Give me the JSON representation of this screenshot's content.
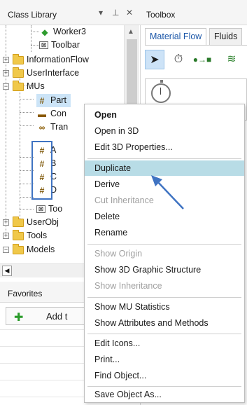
{
  "class_library": {
    "title": "Class Library",
    "header_icons": [
      "dropdown-icon",
      "pin-icon",
      "close-icon"
    ],
    "tree": {
      "items": [
        {
          "label": "Worker3",
          "icon": "worker-icon"
        },
        {
          "label": "Toolbar",
          "icon": "toolbar-icon"
        },
        {
          "label": "InformationFlow",
          "icon": "folder-icon"
        },
        {
          "label": "UserInterface",
          "icon": "folder-icon"
        },
        {
          "label": "MUs",
          "icon": "folder-icon"
        },
        {
          "label": "Part",
          "icon": "mu-part-icon"
        },
        {
          "label": "Con",
          "icon": "mu-container-icon"
        },
        {
          "label": "Tran",
          "icon": "mu-transporter-icon"
        },
        {
          "label": "A",
          "icon": "mu-part-icon"
        },
        {
          "label": "B",
          "icon": "mu-part-icon"
        },
        {
          "label": "C",
          "icon": "mu-part-icon"
        },
        {
          "label": "D",
          "icon": "mu-part-icon"
        },
        {
          "label": "Too",
          "icon": "toolbar-icon"
        },
        {
          "label": "UserObj",
          "icon": "folder-icon"
        },
        {
          "label": "Tools",
          "icon": "folder-icon"
        },
        {
          "label": "Models",
          "icon": "folder-icon"
        }
      ]
    }
  },
  "favorites": {
    "title": "Favorites",
    "add_label": "Add t"
  },
  "toolbox": {
    "title": "Toolbox",
    "tabs": [
      {
        "label": "Material Flow",
        "active": true
      },
      {
        "label": "Fluids",
        "active": false
      }
    ],
    "tools": [
      "pointer-icon",
      "stopwatch-icon",
      "connector-icon",
      "layers-icon"
    ]
  },
  "context_menu": {
    "items": [
      {
        "label": "Open",
        "state": "bold"
      },
      {
        "label": "Open in 3D",
        "state": "normal"
      },
      {
        "label": "Edit 3D Properties...",
        "state": "normal"
      },
      {
        "label": "Duplicate",
        "state": "hover"
      },
      {
        "label": "Derive",
        "state": "normal"
      },
      {
        "label": "Cut Inheritance",
        "state": "disabled"
      },
      {
        "label": "Delete",
        "state": "normal"
      },
      {
        "label": "Rename",
        "state": "normal"
      },
      {
        "label": "Show Origin",
        "state": "disabled"
      },
      {
        "label": "Show 3D Graphic Structure",
        "state": "normal"
      },
      {
        "label": "Show Inheritance",
        "state": "disabled"
      },
      {
        "label": "Show MU Statistics",
        "state": "normal"
      },
      {
        "label": "Show Attributes and Methods",
        "state": "normal"
      },
      {
        "label": "Edit Icons...",
        "state": "normal"
      },
      {
        "label": "Print...",
        "state": "normal"
      },
      {
        "label": "Find Object...",
        "state": "normal"
      },
      {
        "label": "Save Object As...",
        "state": "normal"
      }
    ]
  },
  "colors": {
    "highlight": "#b8dce6",
    "annotation": "#3f73c2",
    "folder": "#f0c84a"
  }
}
